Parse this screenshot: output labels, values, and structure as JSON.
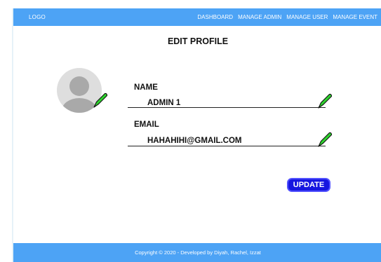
{
  "navbar": {
    "logo": "LOGO",
    "links": [
      "DASHBOARD",
      "MANAGE ADMIN",
      "MANAGE USER",
      "MANAGE EVENT"
    ]
  },
  "page": {
    "title": "EDIT PROFILE"
  },
  "avatar": {
    "icon": "user-avatar-icon",
    "edit_icon": "pencil-icon"
  },
  "form": {
    "name": {
      "label": "NAME",
      "value": "ADMIN 1",
      "edit_icon": "pencil-icon"
    },
    "email": {
      "label": "EMAIL",
      "value": "HAHAHIHI@GMAIL.COM",
      "edit_icon": "pencil-icon"
    },
    "update_label": "UPDATE"
  },
  "footer": {
    "text": "Copyright © 2020 - Developed by Diyah, Rachel, Izzat"
  },
  "colors": {
    "brand_blue": "#4da3f5",
    "button_blue": "#1616e0",
    "pencil_green": "#2ed12e"
  }
}
